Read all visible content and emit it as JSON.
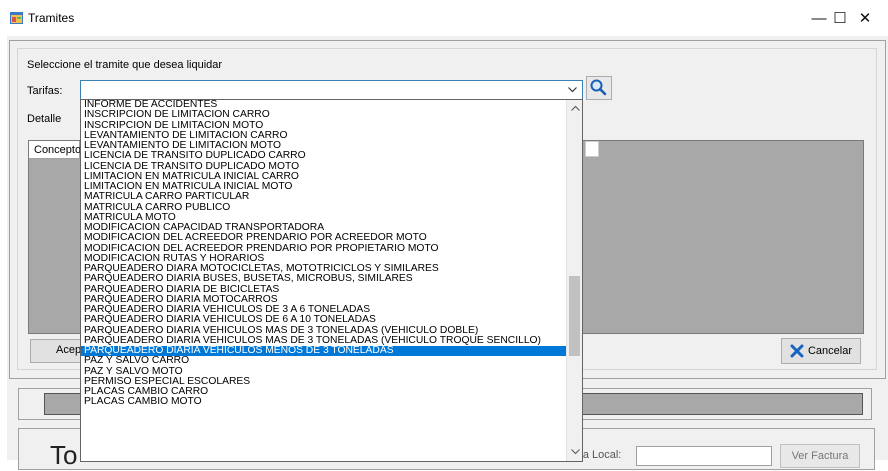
{
  "window": {
    "title": "Tramites",
    "minimize_glyph": "—",
    "maximize_glyph": "☐",
    "close_glyph": "✕"
  },
  "form": {
    "prompt": "Seleccione el tramite que desea liquidar",
    "tarifas_label": "Tarifas:",
    "tarifas_value": "",
    "detalle_label": "Detalle",
    "grid_header": "Concepto",
    "aceptar_label": "Acept",
    "cancelar_label": "Cancelar"
  },
  "bottom": {
    "big_text": "To",
    "factura_local_label": "tura Local:",
    "factura_local_value": "",
    "ver_factura_label": "Ver Factura"
  },
  "icons": {
    "app": "app-window-icon",
    "search": "magnifier-icon",
    "cancel": "red-x-icon",
    "dropdown_arrow": "chevron-down-icon"
  },
  "colors": {
    "selection": "#0078d7",
    "cancel_x": "#1565c0",
    "combo_border": "#3c7fb1"
  },
  "dropdown": {
    "selected_index": 29,
    "items": [
      "INFORME DE ACCIDENTES",
      "INSCRIPCION DE LIMITACION CARRO",
      "INSCRIPCION DE LIMITACION MOTO",
      "LEVANTAMIENTO DE LIMITACION CARRO",
      "LEVANTAMIENTO DE LIMITACION MOTO",
      "LICENCIA DE TRANSITO DUPLICADO CARRO",
      "LICENCIA DE TRANSITO DUPLICADO MOTO",
      "LIMITACION EN MATRICULA INICIAL CARRO",
      "LIMITACION EN MATRICULA INICIAL MOTO",
      "MATRICULA CARRO PARTICULAR",
      "MATRICULA CARRO PUBLICO",
      "MATRICULA MOTO",
      "MODIFICACION CAPACIDAD TRANSPORTADORA",
      "MODIFICACION DEL ACREEDOR PRENDARIO POR ACREEDOR MOTO",
      "MODIFICACION DEL ACREEDOR PRENDARIO POR PROPIETARIO MOTO",
      "MODIFICACIÓN RUTAS Y HORARIOS",
      "PARQUEADERO DIARA MOTOCICLETAS, MOTOTRICICLOS Y SIMILARES",
      "PARQUEADERO DIARIA BUSES, BUSETAS,  MICROBUS, SIMILARES",
      "PARQUEADERO DIARIA DE BICICLETAS",
      "PARQUEADERO DIARIA MOTOCARROS",
      "PARQUEADERO DIARIA VEHICULOS DE 3 A 6 TONELADAS",
      "PARQUEADERO DIARIA VEHICULOS DE 6 A 10 TONELADAS",
      "PARQUEADERO DIARIA VEHICULOS MAS DE 3 TONELADAS (VEHICULO DOBLE)",
      "PARQUEADERO DIARIA VEHICULOS MAS DE 3 TONELADAS (VEHICULO TROQUE SENCILLO)",
      "PARQUEADERO DIARIA VEHICULOS MENOS DE 3 TONELADAS",
      "PAZ Y SALVO CARRO",
      "PAZ Y SALVO MOTO",
      "PERMISO ESPECIAL ESCOLARES",
      "PLACAS CAMBIO CARRO",
      "PLACAS CAMBIO MOTO"
    ]
  }
}
